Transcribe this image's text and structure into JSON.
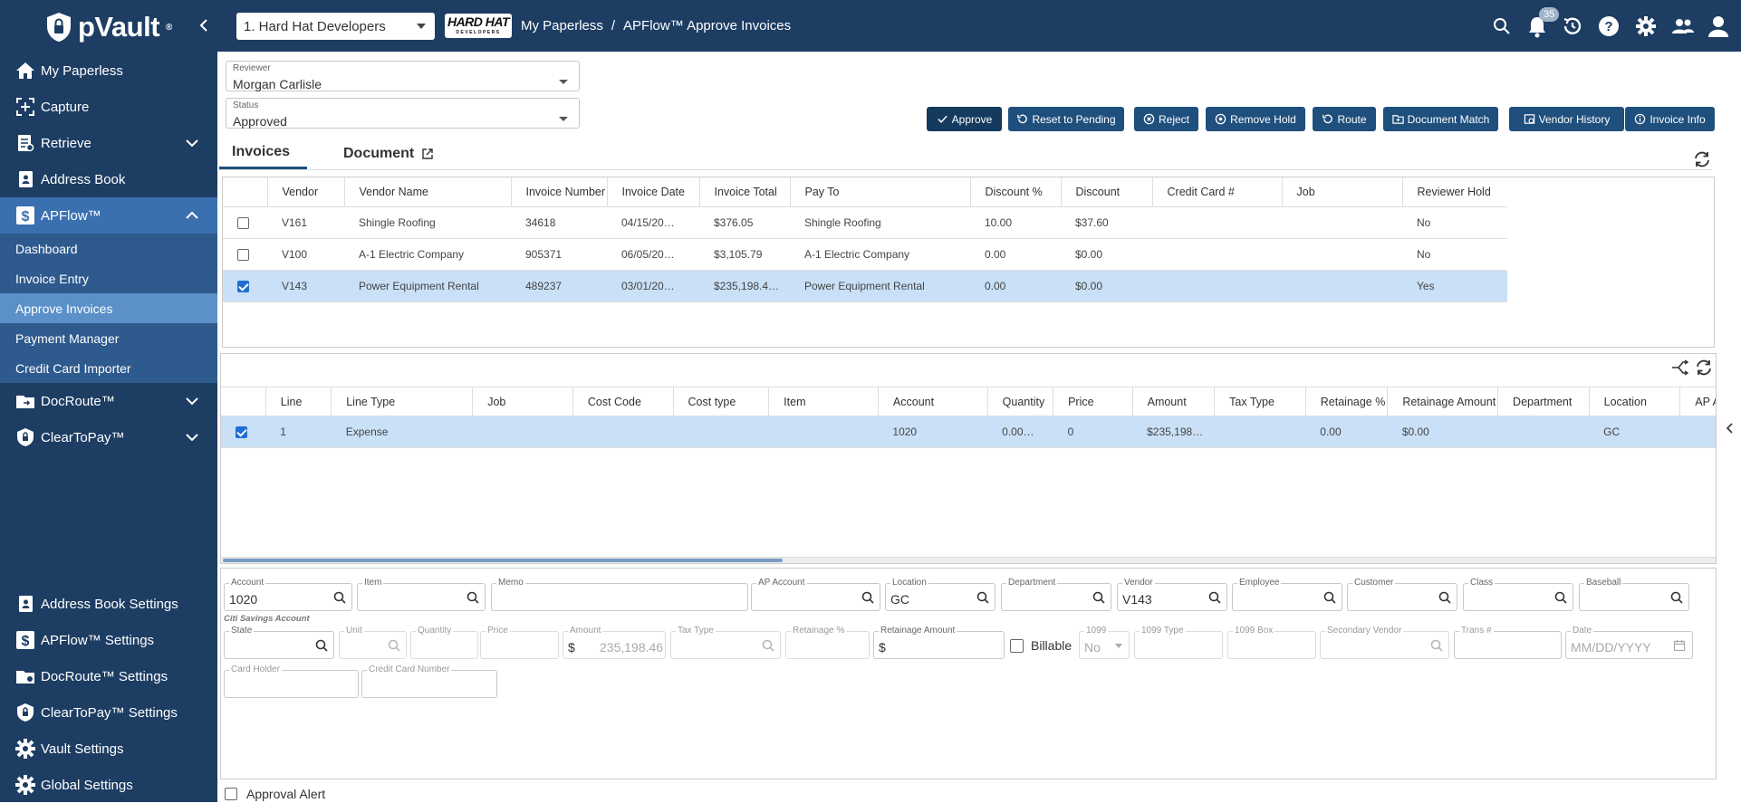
{
  "topbar": {
    "brand": "pVault",
    "brand_tm": "®",
    "company_select": "1. Hard Hat Developers",
    "company_logo_text": "HARD HAT",
    "company_logo_sub": "DEVELOPERS",
    "breadcrumb": [
      "My Paperless",
      "APFlow™ Approve Invoices"
    ],
    "notification_count": "35",
    "icons": [
      "search-icon",
      "bell-icon",
      "history-icon",
      "help-icon",
      "settings-icon",
      "users-icon",
      "profile-icon"
    ]
  },
  "sidebar": {
    "items": [
      {
        "label": "My Paperless",
        "icon": "home-icon"
      },
      {
        "label": "Capture",
        "icon": "capture-icon"
      },
      {
        "label": "Retrieve",
        "icon": "retrieve-icon",
        "expandable": true
      },
      {
        "label": "Address Book",
        "icon": "address-book-icon"
      },
      {
        "label": "APFlow™",
        "icon": "dollar-icon",
        "expanded": true
      }
    ],
    "apflow_sub": [
      "Dashboard",
      "Invoice Entry",
      "Approve Invoices",
      "Payment Manager",
      "Credit Card Importer"
    ],
    "lower_items": [
      {
        "label": "DocRoute™",
        "icon": "docroute-icon"
      },
      {
        "label": "ClearToPay™",
        "icon": "cleartopay-icon"
      }
    ],
    "settings": [
      {
        "label": "Address Book Settings",
        "icon": "address-book-icon"
      },
      {
        "label": "APFlow™ Settings",
        "icon": "dollar-icon"
      },
      {
        "label": "DocRoute™ Settings",
        "icon": "docroute-icon"
      },
      {
        "label": "ClearToPay™ Settings",
        "icon": "cleartopay-icon"
      },
      {
        "label": "Vault Settings",
        "icon": "gear-icon"
      },
      {
        "label": "Global Settings",
        "icon": "gear-icon"
      }
    ]
  },
  "filters": {
    "reviewer_label": "Reviewer",
    "reviewer_value": "Morgan Carlisle",
    "status_label": "Status",
    "status_value": "Approved"
  },
  "actions": [
    "Approve",
    "Reset to Pending",
    "Reject",
    "Remove Hold",
    "Route",
    "Document Match",
    "Vendor History",
    "Invoice Info"
  ],
  "tabs": [
    "Invoices",
    "Document"
  ],
  "invoices": {
    "columns": [
      "Vendor",
      "Vendor Name",
      "Invoice Number",
      "Invoice Date",
      "Invoice Total",
      "Pay To",
      "Discount %",
      "Discount",
      "Credit Card #",
      "Job",
      "Reviewer Hold"
    ],
    "rows": [
      {
        "checked": false,
        "cells": [
          "V161",
          "Shingle Roofing",
          "34618",
          "04/15/20…",
          "$376.05",
          "Shingle Roofing",
          "10.00",
          "$37.60",
          "",
          "",
          "No"
        ]
      },
      {
        "checked": false,
        "cells": [
          "V100",
          "A-1 Electric Company",
          "905371",
          "06/05/20…",
          "$3,105.79",
          "A-1 Electric Company",
          "0.00",
          "$0.00",
          "",
          "",
          "No"
        ]
      },
      {
        "checked": true,
        "cells": [
          "V143",
          "Power Equipment Rental",
          "489237",
          "03/01/20…",
          "$235,198.4…",
          "Power Equipment Rental",
          "0.00",
          "$0.00",
          "",
          "",
          "Yes"
        ]
      }
    ]
  },
  "lines": {
    "columns": [
      "Line",
      "Line Type",
      "Job",
      "Cost Code",
      "Cost type",
      "Item",
      "Account",
      "Quantity",
      "Price",
      "Amount",
      "Tax Type",
      "Retainage %",
      "Retainage Amount",
      "Department",
      "Location",
      "AP Ac"
    ],
    "rows": [
      {
        "checked": true,
        "cells": [
          "1",
          "Expense",
          "",
          "",
          "",
          "",
          "1020",
          "0.00…",
          "0",
          "$235,198…",
          "",
          "0.00",
          "$0.00",
          "",
          "GC",
          ""
        ]
      }
    ]
  },
  "detail": {
    "row1": [
      {
        "label": "Account",
        "value": "1020"
      },
      {
        "label": "Item",
        "value": ""
      },
      {
        "label": "Memo",
        "value": ""
      },
      {
        "label": "AP Account",
        "value": ""
      },
      {
        "label": "Location",
        "value": "GC"
      },
      {
        "label": "Department",
        "value": ""
      },
      {
        "label": "Vendor",
        "value": "V143"
      },
      {
        "label": "Employee",
        "value": ""
      },
      {
        "label": "Customer",
        "value": ""
      },
      {
        "label": "Class",
        "value": ""
      },
      {
        "label": "Baseball",
        "value": ""
      }
    ],
    "account_hint": "Citi Savings Account",
    "row2": [
      {
        "label": "State",
        "value": ""
      },
      {
        "label": "Unit",
        "value": ""
      },
      {
        "label": "Quantity",
        "value": ""
      },
      {
        "label": "Price",
        "value": ""
      },
      {
        "label": "Amount",
        "value": "235,198.46",
        "prefix": "$"
      },
      {
        "label": "Tax Type",
        "value": ""
      },
      {
        "label": "Retainage %",
        "value": ""
      },
      {
        "label": "Retainage Amount",
        "value": "",
        "prefix": "$"
      },
      {
        "label": "1099",
        "value": "No"
      },
      {
        "label": "1099 Type",
        "value": ""
      },
      {
        "label": "1099 Box",
        "value": ""
      },
      {
        "label": "Secondary Vendor",
        "value": ""
      },
      {
        "label": "Trans #",
        "value": ""
      },
      {
        "label": "Date",
        "value": "MM/DD/YYYY"
      }
    ],
    "billable_label": "Billable",
    "row3": [
      {
        "label": "Card Holder",
        "value": ""
      },
      {
        "label": "Credit Card Number",
        "value": ""
      }
    ],
    "approval_alert_label": "Approval Alert"
  }
}
